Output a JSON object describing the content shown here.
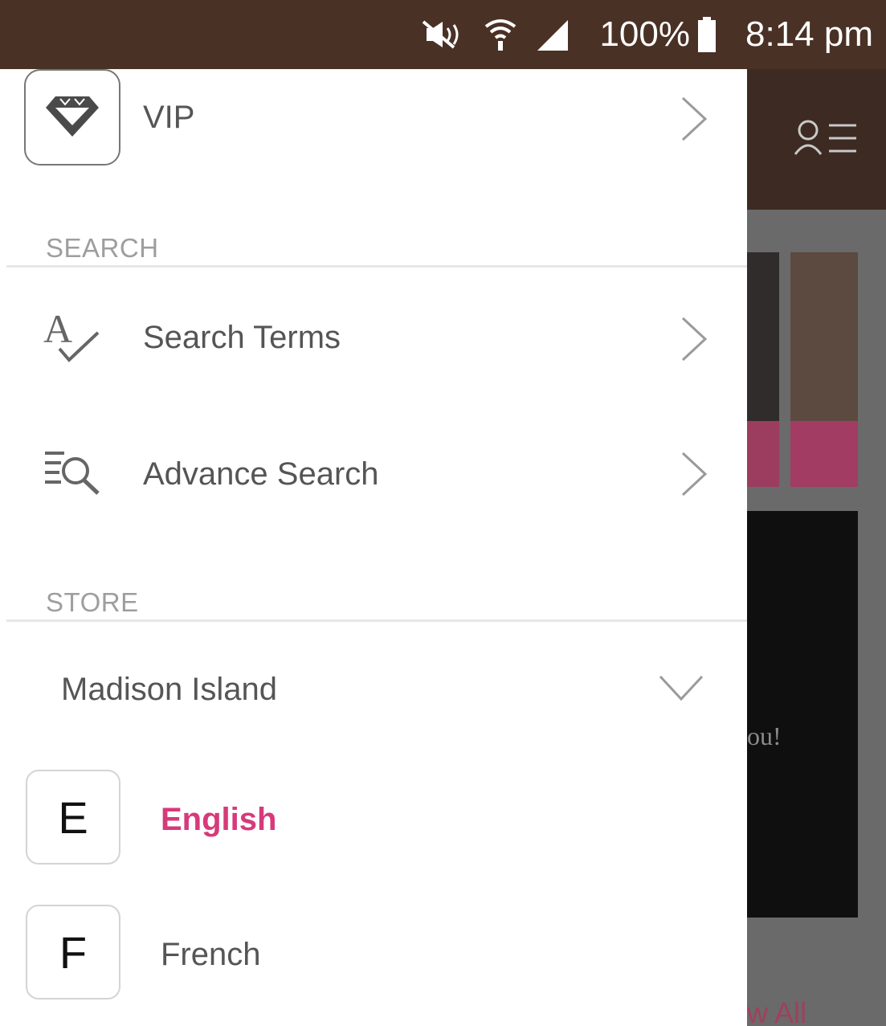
{
  "status_bar": {
    "battery_pct": "100%",
    "time": "8:14 pm",
    "icons": [
      "mute-icon",
      "wifi-icon",
      "signal-icon",
      "battery-icon"
    ],
    "background": "#4a3126"
  },
  "drawer": {
    "vip": {
      "label": "VIP",
      "icon": "diamond-icon"
    },
    "search_section": {
      "title": "SEARCH",
      "items": [
        {
          "label": "Search Terms",
          "icon": "spell-check-icon"
        },
        {
          "label": "Advance Search",
          "icon": "list-search-icon"
        }
      ]
    },
    "store_section": {
      "title": "STORE",
      "selected_store": "Madison Island",
      "languages": [
        {
          "letter": "E",
          "label": "English",
          "selected": true
        },
        {
          "letter": "F",
          "label": "French",
          "selected": false
        }
      ]
    }
  },
  "background_app": {
    "partial_text": "ou!",
    "view_all_partial": "w All"
  },
  "colors": {
    "accent_pink": "#d63a7a",
    "header_brown": "#3d2a22",
    "text_gray": "#555555"
  }
}
